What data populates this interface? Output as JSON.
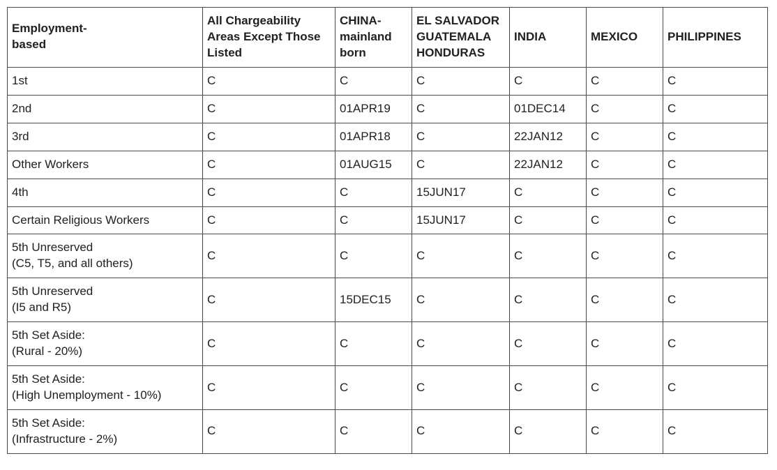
{
  "table": {
    "columns": [
      "Employment-\nbased",
      "All Chargeability Areas Except Those Listed",
      "CHINA-mainland born",
      "EL SALVADOR GUATEMALA HONDURAS",
      "INDIA",
      "MEXICO",
      "PHILIPPINES"
    ],
    "rows": [
      {
        "label": "1st",
        "cells": [
          "C",
          "C",
          "C",
          "C",
          "C",
          "C"
        ]
      },
      {
        "label": "2nd",
        "cells": [
          "C",
          "01APR19",
          "C",
          "01DEC14",
          "C",
          "C"
        ]
      },
      {
        "label": "3rd",
        "cells": [
          "C",
          "01APR18",
          "C",
          "22JAN12",
          "C",
          "C"
        ]
      },
      {
        "label": "Other Workers",
        "cells": [
          "C",
          "01AUG15",
          "C",
          "22JAN12",
          "C",
          "C"
        ]
      },
      {
        "label": "4th",
        "cells": [
          "C",
          "C",
          "15JUN17",
          "C",
          "C",
          "C"
        ]
      },
      {
        "label": "Certain Religious Workers",
        "cells": [
          "C",
          "C",
          "15JUN17",
          "C",
          "C",
          "C"
        ]
      },
      {
        "label": "5th Unreserved\n(C5, T5, and all others)",
        "cells": [
          "C",
          "C",
          "C",
          "C",
          "C",
          "C"
        ]
      },
      {
        "label": "5th Unreserved\n(I5 and R5)",
        "cells": [
          "C",
          "15DEC15",
          "C",
          "C",
          "C",
          "C"
        ]
      },
      {
        "label": "5th Set Aside:\n(Rural - 20%)",
        "cells": [
          "C",
          "C",
          "C",
          "C",
          "C",
          "C"
        ]
      },
      {
        "label": "5th Set Aside:\n(High Unemployment - 10%)",
        "cells": [
          "C",
          "C",
          "C",
          "C",
          "C",
          "C"
        ]
      },
      {
        "label": "5th Set Aside:\n(Infrastructure - 2%)",
        "cells": [
          "C",
          "C",
          "C",
          "C",
          "C",
          "C"
        ]
      }
    ]
  }
}
